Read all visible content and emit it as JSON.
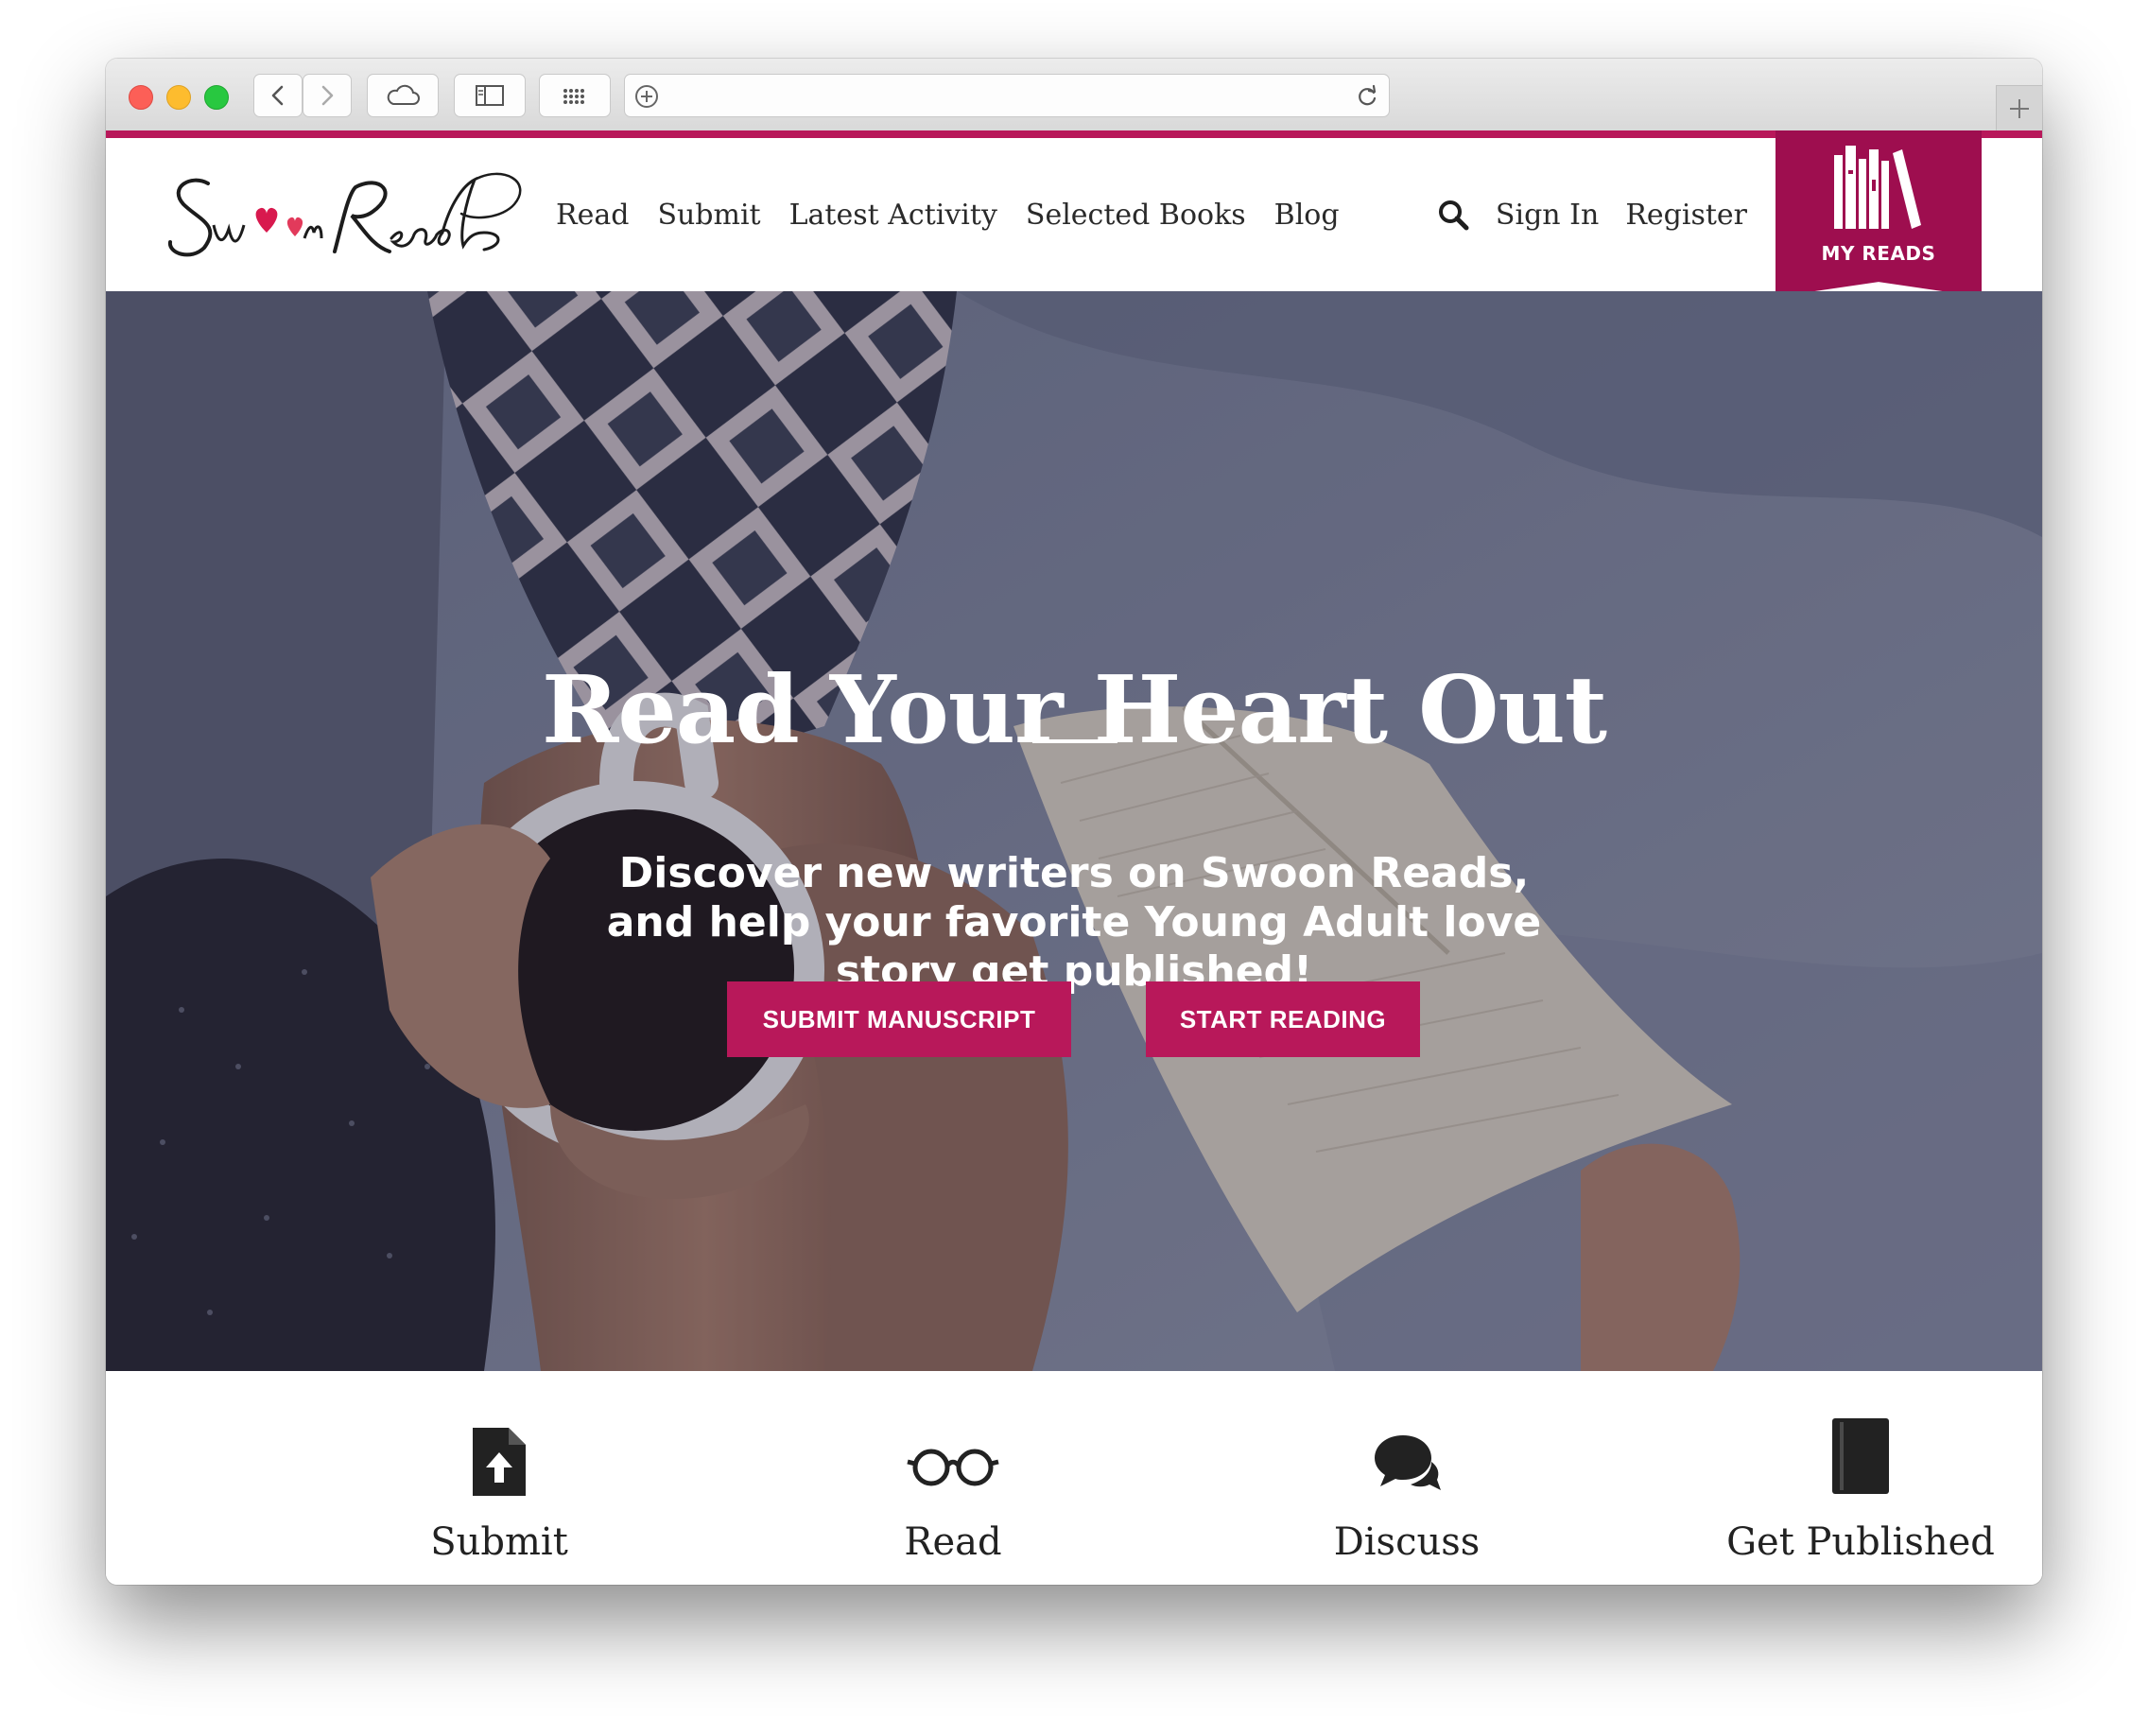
{
  "site": {
    "logo_text": "SwoonReads"
  },
  "nav": {
    "items": [
      {
        "label": "Read"
      },
      {
        "label": "Submit"
      },
      {
        "label": "Latest Activity"
      },
      {
        "label": "Selected Books"
      },
      {
        "label": "Blog"
      }
    ]
  },
  "account": {
    "sign_in": "Sign In",
    "register": "Register",
    "my_reads": "MY READS"
  },
  "hero": {
    "title": "Read Your Heart Out",
    "subtitle": "Discover new writers on Swoon Reads, and help your favorite Young Adult love story get published!",
    "buttons": {
      "submit": "SUBMIT MANUSCRIPT",
      "read": "START READING"
    }
  },
  "features": [
    {
      "label": "Submit",
      "icon": "upload-document-icon"
    },
    {
      "label": "Read",
      "icon": "glasses-icon"
    },
    {
      "label": "Discuss",
      "icon": "chat-bubbles-icon"
    },
    {
      "label": "Get Published",
      "icon": "book-icon"
    }
  ],
  "colors": {
    "brand": "#b8185a",
    "my_reads_bg": "#9e0e4f",
    "text_dark": "#2a2a2a"
  }
}
